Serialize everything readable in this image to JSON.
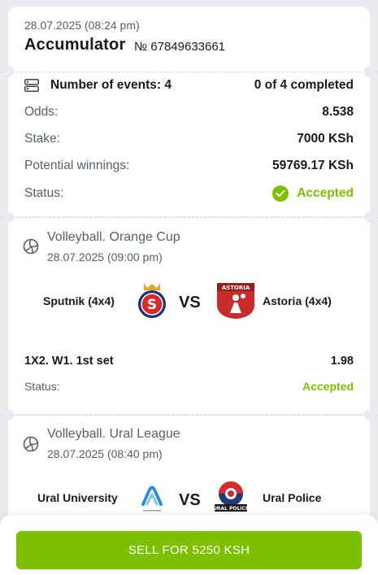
{
  "coupon": {
    "date": "28.07.2025 (08:24 pm)",
    "title": "Accumulator",
    "number": "№ 67849633661"
  },
  "summary": {
    "events_label": "Number of events: 4",
    "completed": "0 of 4 completed",
    "odds_label": "Odds:",
    "odds_value": "8.538",
    "stake_label": "Stake:",
    "stake_value": "7000 KSh",
    "winnings_label": "Potential winnings:",
    "winnings_value": "59769.17 KSh",
    "status_label": "Status:",
    "status_value": "Accepted"
  },
  "events": [
    {
      "sport": "Volleyball. Orange Cup",
      "date": "28.07.2025 (09:00 pm)",
      "team1": "Sputnik (4x4)",
      "team2": "Astoria (4x4)",
      "vs": "VS",
      "team2_logo_text": "ASTORIA",
      "bet": "1X2. W1. 1st set",
      "odds": "1.98",
      "status_label": "Status:",
      "status_value": "Accepted"
    },
    {
      "sport": "Volleyball. Ural League",
      "date": "28.07.2025 (08:40 pm)",
      "team1": "Ural University",
      "team2": "Ural Police",
      "vs": "VS",
      "team2_logo_text": "URAL POLICE"
    }
  ],
  "actions": {
    "sell_label": "SELL FOR 5250 KSH"
  },
  "colors": {
    "accent": "#7cc000",
    "muted_text": "#55606b",
    "background": "#e9ebee"
  }
}
